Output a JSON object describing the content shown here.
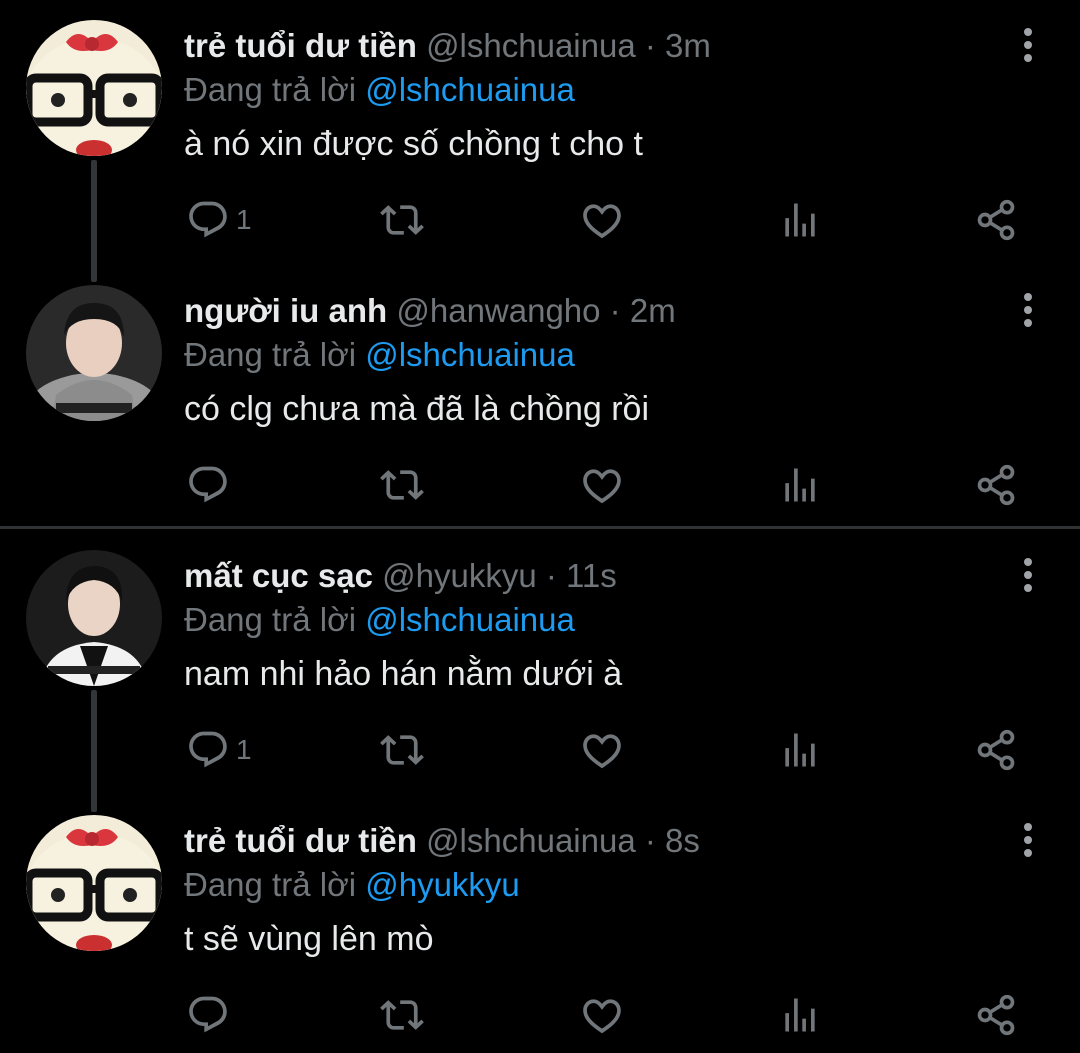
{
  "tweets": [
    {
      "name": "trẻ tuổi dư tiền",
      "handle": "@lshchuainua",
      "dot": " · ",
      "time": "3m",
      "reply_prefix": "Đang trả lời ",
      "reply_to": "@lshchuainua",
      "text": "à nó xin được số chồng t cho t",
      "reply_count": "1",
      "avatar": "hello-kitty-glasses-avatar"
    },
    {
      "name": "người iu anh",
      "handle": "@hanwangho",
      "dot": " · ",
      "time": "2m",
      "reply_prefix": "Đang trả lời ",
      "reply_to": "@lshchuainua",
      "text": "có clg chưa mà đã là chồng rồi",
      "reply_count": "",
      "avatar": "person-gray-hoodie-avatar"
    },
    {
      "name": "mất cục sạc",
      "handle": "@hyukkyu",
      "dot": " · ",
      "time": "11s",
      "reply_prefix": "Đang trả lời ",
      "reply_to": "@lshchuainua",
      "text": "nam nhi hảo hán nằm dưới à",
      "reply_count": "1",
      "avatar": "person-white-jersey-avatar"
    },
    {
      "name": "trẻ tuổi dư tiền",
      "handle": "@lshchuainua",
      "dot": " · ",
      "time": "8s",
      "reply_prefix": "Đang trả lời ",
      "reply_to": "@hyukkyu",
      "text": "t sẽ vùng lên mò",
      "reply_count": "",
      "avatar": "hello-kitty-glasses-avatar"
    }
  ],
  "colors": {
    "background": "#000000",
    "text": "#e7e9ea",
    "secondary": "#71767b",
    "accent": "#1d9bf0",
    "divider": "#2f3336"
  },
  "icons": [
    "reply-icon",
    "retweet-icon",
    "like-icon",
    "stats-icon",
    "share-icon",
    "more-icon"
  ]
}
